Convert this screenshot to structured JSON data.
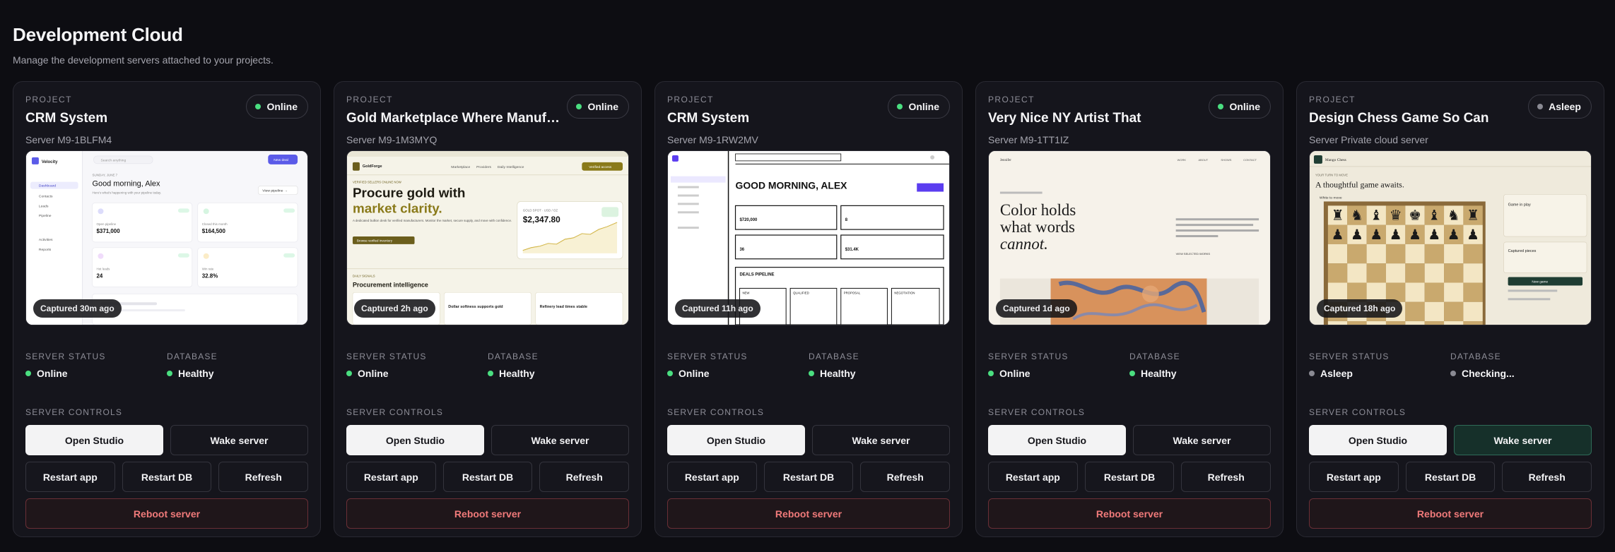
{
  "page": {
    "title": "Development Cloud",
    "subtitle": "Manage the development servers attached to your projects."
  },
  "colors": {
    "online": "#4ade80",
    "asleep": "#8a8a93",
    "danger_text": "#f07a7a",
    "wake_active_bg": "#16302a"
  },
  "labels": {
    "project": "PROJECT",
    "server_status": "SERVER STATUS",
    "database": "DATABASE",
    "server_controls": "SERVER CONTROLS",
    "open_studio": "Open Studio",
    "wake_server": "Wake server",
    "restart_app": "Restart app",
    "restart_db": "Restart DB",
    "refresh": "Refresh",
    "reboot_server": "Reboot server"
  },
  "cards": [
    {
      "name": "CRM System",
      "server": "Server M9-1BLFM4",
      "status": "Online",
      "captured": "Captured 30m ago",
      "server_status": "Online",
      "database": "Healthy",
      "preview": {
        "brand": "Velocity",
        "search": "Search anything",
        "button": "New deal",
        "nav": [
          "Dashboard",
          "Contacts",
          "Leads",
          "Pipeline"
        ],
        "nav2": [
          "Activities",
          "Reports"
        ],
        "eyebrow": "SUNDAY, JUNE 7",
        "greeting": "Good morning, Alex",
        "sub": "Here's what's happening with your pipeline today.",
        "view": "View pipeline →",
        "stats": [
          {
            "label": "Open pipeline",
            "value": "$371,000"
          },
          {
            "label": "Closed this month",
            "value": "$164,500"
          },
          {
            "label": "Hot leads",
            "value": "24"
          },
          {
            "label": "Win rate",
            "value": "32.8%"
          }
        ]
      }
    },
    {
      "name": "Gold Marketplace Where Manufa…",
      "server": "Server M9-1M3MYQ",
      "status": "Online",
      "captured": "Captured 2h ago",
      "server_status": "Online",
      "database": "Healthy",
      "preview": {
        "brand": "GoldForge",
        "nav": [
          "Marketplace",
          "Providers",
          "Daily Intelligence"
        ],
        "cta": "Verified access",
        "eyebrow": "VERIFIED SELLERS ONLINE NOW",
        "headline1": "Procure gold with",
        "headline2": "market clarity.",
        "body": "A dedicated bullion desk for verified manufacturers. Monitor the market, secure supply, and move with confidence.",
        "btn": "Browse verified inventory",
        "spot_label": "GOLD SPOT · USD / OZ",
        "spot": "$2,347.80",
        "section_eyebrow": "DAILY SIGNALS",
        "section": "Procurement intelligence",
        "news": [
          "Dollar softness supports gold",
          "Refinery lead times stable"
        ]
      }
    },
    {
      "name": "CRM System",
      "server": "Server M9-1RW2MV",
      "status": "Online",
      "captured": "Captured 11h ago",
      "server_status": "Online",
      "database": "Healthy",
      "preview": {
        "greeting": "GOOD MORNING, ALEX",
        "stats": [
          "$720,000",
          "8",
          "36",
          "$31.4K"
        ],
        "pipeline": "DEALS PIPELINE",
        "stages": [
          "NEW",
          "QUALIFIED",
          "PROPOSAL",
          "NEGOTIATION"
        ]
      }
    },
    {
      "name": "Very Nice NY Artist That",
      "server": "Server M9-1TT1IZ",
      "status": "Online",
      "captured": "Captured 1d ago",
      "server_status": "Online",
      "database": "Healthy",
      "preview": {
        "brand": "Jennifer",
        "nav": [
          "WORK",
          "ABOUT",
          "SHOWS",
          "CONTACT"
        ],
        "lines": [
          "Color holds",
          "what words",
          "cannot."
        ],
        "link": "VIEW SELECTED WORKS"
      }
    },
    {
      "name": "Design Chess Game So Can",
      "server": "Server Private cloud server",
      "status": "Asleep",
      "captured": "Captured 18h ago",
      "server_status": "Asleep",
      "database": "Checking...",
      "preview": {
        "brand": "Mango Chess",
        "eyebrow": "YOUR TURN TO MOVE",
        "title": "A thoughtful game awaits.",
        "side": "White to move",
        "panel1": "Game in play",
        "panel2": "Captured pieces",
        "btn": "New game"
      }
    }
  ]
}
